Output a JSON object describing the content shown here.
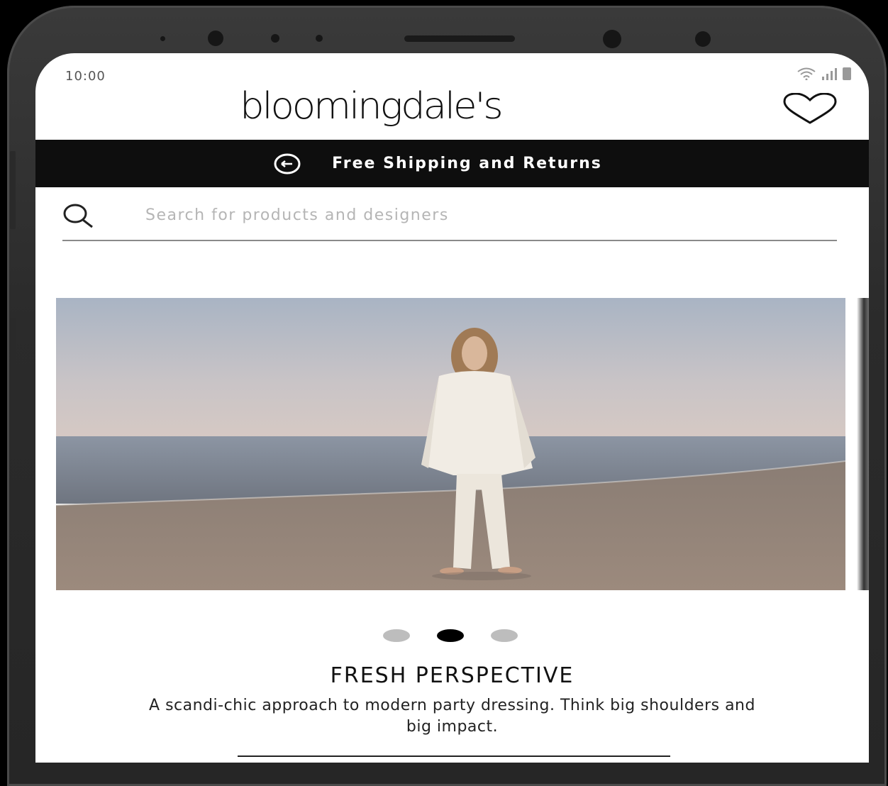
{
  "status_bar": {
    "time": "10:00",
    "icons": [
      "wifi-icon",
      "signal-icon",
      "battery-icon"
    ]
  },
  "header": {
    "logo_text": "bloomingdale's",
    "wishlist_icon": "heart-icon"
  },
  "promo_banner": {
    "icon": "return-arrow-icon",
    "text": "Free Shipping and Returns",
    "background": "#0e0e0e"
  },
  "search": {
    "icon": "search-icon",
    "placeholder": "Search for products and designers"
  },
  "carousel": {
    "slide_count": 3,
    "active_index": 1
  },
  "feature": {
    "headline": "FRESH PERSPECTIVE",
    "description": "A scandi-chic approach to modern party dressing. Think big shoulders and big impact."
  }
}
